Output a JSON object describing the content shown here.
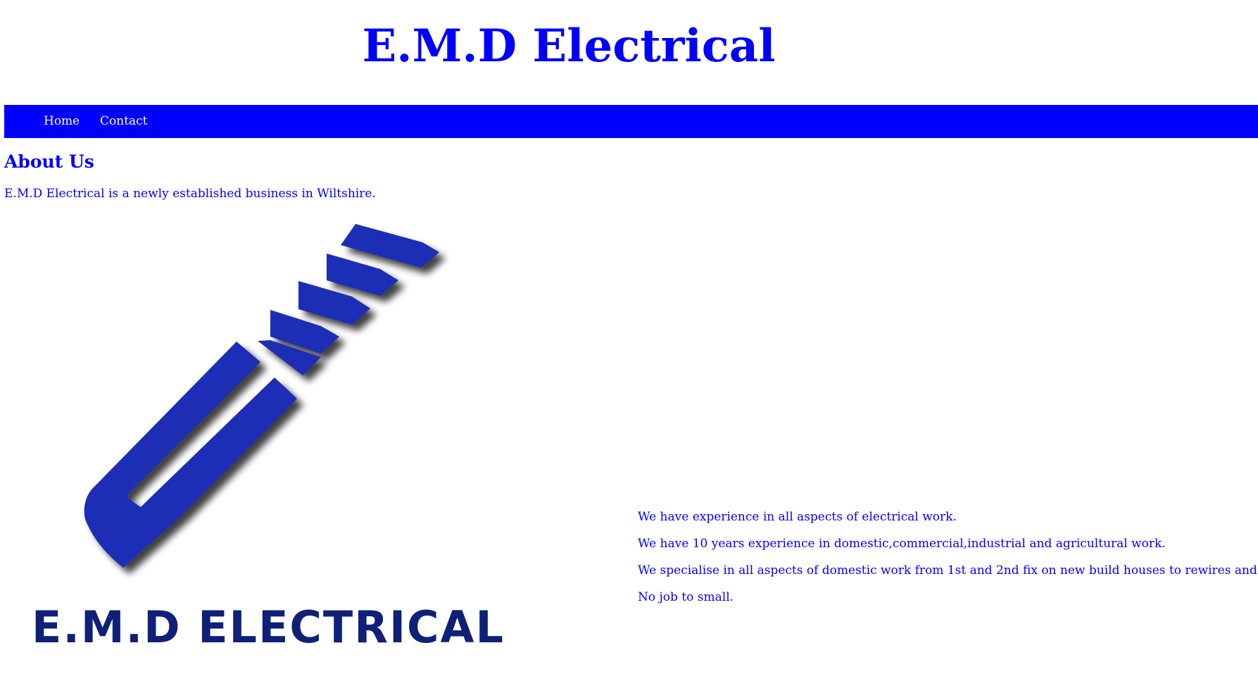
{
  "header": {
    "title": "E.M.D Electrical"
  },
  "nav": {
    "items": [
      {
        "label": "Home"
      },
      {
        "label": "Contact"
      }
    ]
  },
  "about": {
    "heading": "About Us",
    "intro": "E.M.D Electrical is a newly established business in Wiltshire.",
    "logo_text": "E.M.D ELECTRICAL",
    "points": [
      "We have experience in all aspects of electrical work.",
      "We have 10 years experience in domestic,commercial,industrial and agricultural work.",
      "We specialise in all aspects of domestic work from 1st and 2nd fix on new build houses to rewires and fault fi",
      "No job to small."
    ]
  },
  "colors": {
    "brand": "#0000ff",
    "logo": "#1a2fb5",
    "nav_text": "#ffffff",
    "background": "#ffffff"
  },
  "icons": {
    "logo": "emd-plug-logo-icon"
  }
}
